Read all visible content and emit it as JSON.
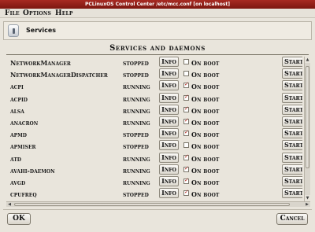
{
  "window": {
    "title": "PCLinuxOS Control Center /etc/mcc.conf [on localhost]"
  },
  "menubar": {
    "items": [
      "File",
      "Options",
      "Help"
    ]
  },
  "header": {
    "title": "Services",
    "icon": "services-icon"
  },
  "section": {
    "title": "Services and daemons"
  },
  "columns": {
    "info_label": "Info",
    "onboot_label": "On boot",
    "start_label": "Start"
  },
  "services": [
    {
      "name": "NetworkManager",
      "status": "stopped",
      "on_boot": false
    },
    {
      "name": "NetworkManagerDispatcher",
      "status": "stopped",
      "on_boot": false
    },
    {
      "name": "acpi",
      "status": "running",
      "on_boot": true
    },
    {
      "name": "acpid",
      "status": "running",
      "on_boot": true
    },
    {
      "name": "alsa",
      "status": "running",
      "on_boot": true
    },
    {
      "name": "anacron",
      "status": "running",
      "on_boot": true
    },
    {
      "name": "apmd",
      "status": "stopped",
      "on_boot": true
    },
    {
      "name": "apmiser",
      "status": "stopped",
      "on_boot": false
    },
    {
      "name": "atd",
      "status": "running",
      "on_boot": true
    },
    {
      "name": "avahi-daemon",
      "status": "running",
      "on_boot": true
    },
    {
      "name": "avgd",
      "status": "running",
      "on_boot": true
    },
    {
      "name": "cpufreq",
      "status": "stopped",
      "on_boot": true
    }
  ],
  "footer": {
    "ok_label": "OK",
    "cancel_label": "Cancel"
  },
  "colors": {
    "titlebar": "#8f1f18",
    "checkmark": "#b0281e",
    "background": "#e9e5dc"
  }
}
